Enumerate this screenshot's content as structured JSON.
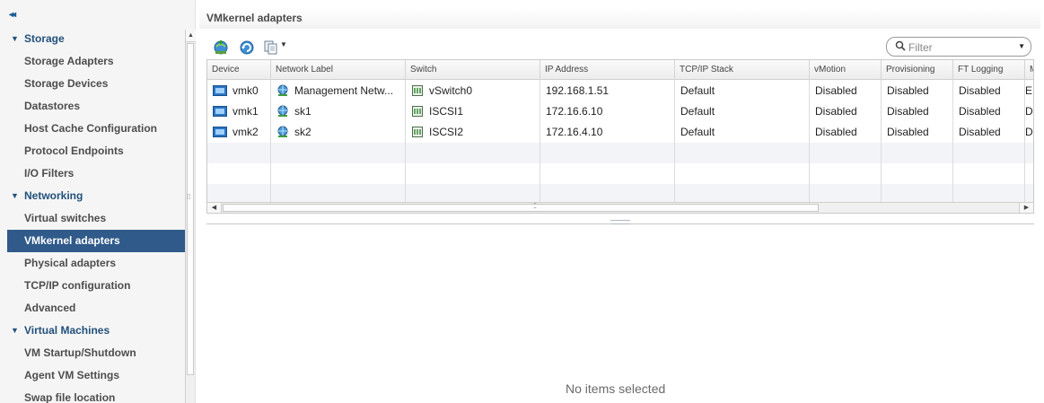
{
  "sidebar": {
    "collapse_glyph": "◂◂",
    "items": [
      {
        "label": "Storage",
        "type": "section"
      },
      {
        "label": "Storage Adapters",
        "type": "item"
      },
      {
        "label": "Storage Devices",
        "type": "item"
      },
      {
        "label": "Datastores",
        "type": "item"
      },
      {
        "label": "Host Cache Configuration",
        "type": "item"
      },
      {
        "label": "Protocol Endpoints",
        "type": "item"
      },
      {
        "label": "I/O Filters",
        "type": "item"
      },
      {
        "label": "Networking",
        "type": "section"
      },
      {
        "label": "Virtual switches",
        "type": "item"
      },
      {
        "label": "VMkernel adapters",
        "type": "item",
        "active": true
      },
      {
        "label": "Physical adapters",
        "type": "item"
      },
      {
        "label": "TCP/IP configuration",
        "type": "item"
      },
      {
        "label": "Advanced",
        "type": "item"
      },
      {
        "label": "Virtual Machines",
        "type": "section"
      },
      {
        "label": "VM Startup/Shutdown",
        "type": "item"
      },
      {
        "label": "Agent VM Settings",
        "type": "item"
      },
      {
        "label": "Swap file location",
        "type": "item"
      }
    ]
  },
  "main": {
    "title": "VMkernel adapters",
    "toolbar": {
      "icons": [
        "add-networking-icon",
        "refresh-icon",
        "copy-settings-icon"
      ]
    },
    "filter": {
      "placeholder": "Filter"
    },
    "table": {
      "columns": [
        "Device",
        "Network Label",
        "Switch",
        "IP Address",
        "TCP/IP Stack",
        "vMotion",
        "Provisioning",
        "FT Logging",
        "M"
      ],
      "rows": [
        {
          "device": "vmk0",
          "network_label": "Management Netw...",
          "switch": "vSwitch0",
          "ip": "192.168.1.51",
          "stack": "Default",
          "vmotion": "Disabled",
          "provisioning": "Disabled",
          "ft_logging": "Disabled",
          "m": "E"
        },
        {
          "device": "vmk1",
          "network_label": "sk1",
          "switch": "ISCSI1",
          "ip": "172.16.6.10",
          "stack": "Default",
          "vmotion": "Disabled",
          "provisioning": "Disabled",
          "ft_logging": "Disabled",
          "m": "D"
        },
        {
          "device": "vmk2",
          "network_label": "sk2",
          "switch": "ISCSI2",
          "ip": "172.16.4.10",
          "stack": "Default",
          "vmotion": "Disabled",
          "provisioning": "Disabled",
          "ft_logging": "Disabled",
          "m": "D"
        }
      ]
    },
    "details": {
      "empty_message": "No items selected"
    }
  },
  "colors": {
    "accent": "#2f5a8a",
    "section_text": "#22517c"
  }
}
